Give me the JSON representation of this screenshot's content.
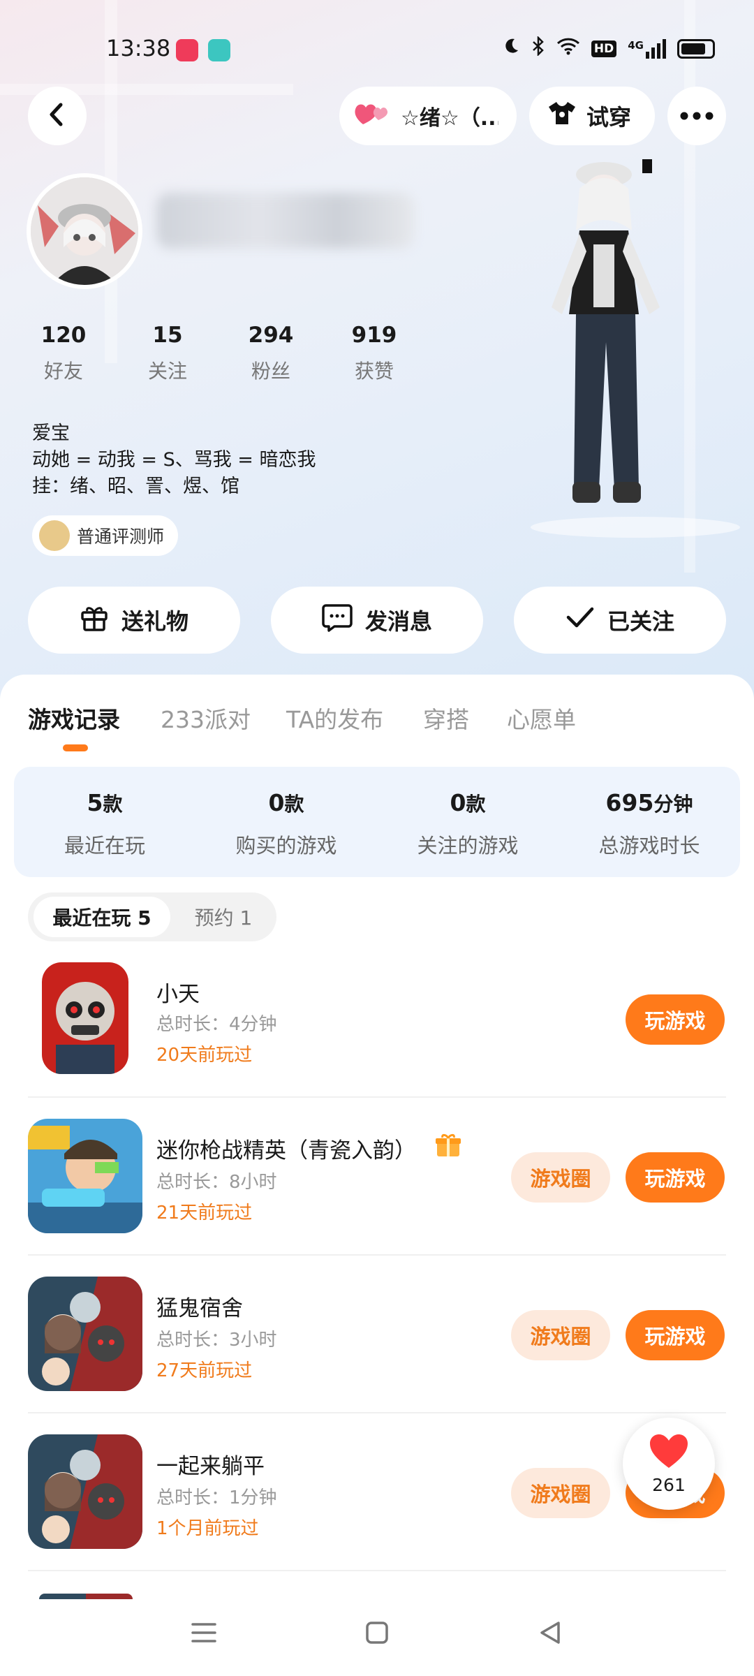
{
  "status_bar": {
    "time": "13:38",
    "network": "4G",
    "hd": "HD",
    "icons": [
      "moon-icon",
      "bluetooth-icon",
      "wifi-icon",
      "hd-icon",
      "signal-icon",
      "battery-icon"
    ]
  },
  "header": {
    "back_icon": "back-arrow-icon",
    "couple_label": "☆绪☆（...",
    "try_on_label": "试穿",
    "more_icon": "more-icon"
  },
  "profile": {
    "stats": [
      {
        "value": "120",
        "label": "好友"
      },
      {
        "value": "15",
        "label": "关注"
      },
      {
        "value": "294",
        "label": "粉丝"
      },
      {
        "value": "919",
        "label": "获赞"
      }
    ],
    "bio_lines": [
      "爱宝",
      "动她 = 动我 = S、骂我 = 暗恋我",
      "挂：绪、昭、詈、煜、馆"
    ],
    "badge_label": "普通评测师"
  },
  "actions": {
    "gift": "送礼物",
    "message": "发消息",
    "follow": "已关注"
  },
  "tabs": [
    "游戏记录",
    "233派对",
    "TA的发布",
    "穿搭",
    "心愿单"
  ],
  "summary": [
    {
      "num": "5",
      "unit": "款",
      "label": "最近在玩"
    },
    {
      "num": "0",
      "unit": "款",
      "label": "购买的游戏"
    },
    {
      "num": "0",
      "unit": "款",
      "label": "关注的游戏"
    },
    {
      "num": "695",
      "unit": "分钟",
      "label": "总游戏时长"
    }
  ],
  "segments": [
    "最近在玩 5",
    "预约 1"
  ],
  "games": [
    {
      "name": "小天",
      "duration": "总时长：4分钟",
      "last": "20天前玩过",
      "play": "玩游戏"
    },
    {
      "name": "迷你枪战精英（青瓷入韵）",
      "duration": "总时长：8小时",
      "last": "21天前玩过",
      "circle": "游戏圈",
      "play": "玩游戏"
    },
    {
      "name": "猛鬼宿舍",
      "duration": "总时长：3小时",
      "last": "27天前玩过",
      "circle": "游戏圈",
      "play": "玩游戏"
    },
    {
      "name": "一起来躺平",
      "duration": "总时长：1分钟",
      "last": "1个月前玩过",
      "circle": "游戏圈",
      "play": "玩游戏"
    }
  ],
  "like_float": {
    "count": "261"
  },
  "colors": {
    "accent": "#ff7a1a",
    "accent_light": "#fde9dc",
    "summary_bg": "#eef4fd"
  }
}
